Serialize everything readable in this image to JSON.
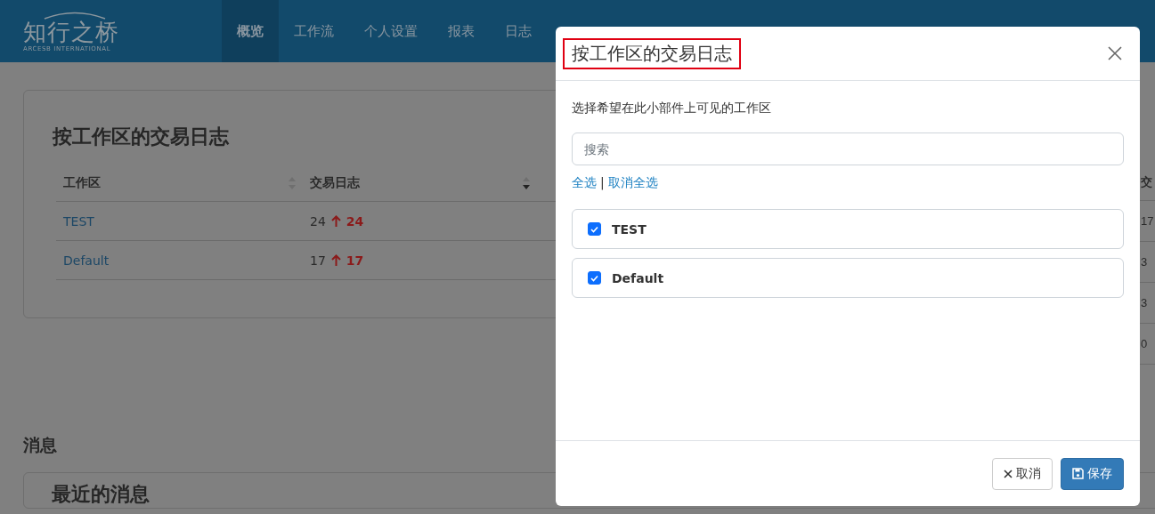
{
  "header": {
    "logo": {
      "title": "知行之桥",
      "subtitle": "ARCESB INTERNATIONAL"
    },
    "nav": [
      {
        "label": "概览",
        "selected": true
      },
      {
        "label": "工作流",
        "selected": false
      },
      {
        "label": "个人设置",
        "selected": false
      },
      {
        "label": "报表",
        "selected": false
      },
      {
        "label": "日志",
        "selected": false
      }
    ]
  },
  "widget": {
    "title": "按工作区的交易日志",
    "columns": [
      {
        "label": "工作区",
        "sorted": false
      },
      {
        "label": "交易日志",
        "sorted": true
      }
    ],
    "rows": [
      {
        "workspace": "TEST",
        "count": "24",
        "rising": true,
        "change": "24"
      },
      {
        "workspace": "Default",
        "count": "17",
        "rising": true,
        "change": "17"
      }
    ]
  },
  "side_table": {
    "column_1": "交",
    "rows": [
      "17",
      "3",
      "3",
      "0"
    ]
  },
  "messages": {
    "heading": "消息",
    "card_title": "最近的消息"
  },
  "dialog": {
    "title": "按工作区的交易日志",
    "title_highlighted": true,
    "description": "选择希望在此小部件上可见的工作区",
    "search": {
      "placeholder": "搜索"
    },
    "select_all": "全选",
    "separator": "|",
    "deselect_all": "取消全选",
    "items": [
      {
        "label": "TEST",
        "checked": true
      },
      {
        "label": "Default",
        "checked": true
      }
    ],
    "buttons": [
      {
        "kind": "cancel",
        "label": "取消"
      },
      {
        "kind": "save",
        "label": "保存"
      }
    ]
  }
}
